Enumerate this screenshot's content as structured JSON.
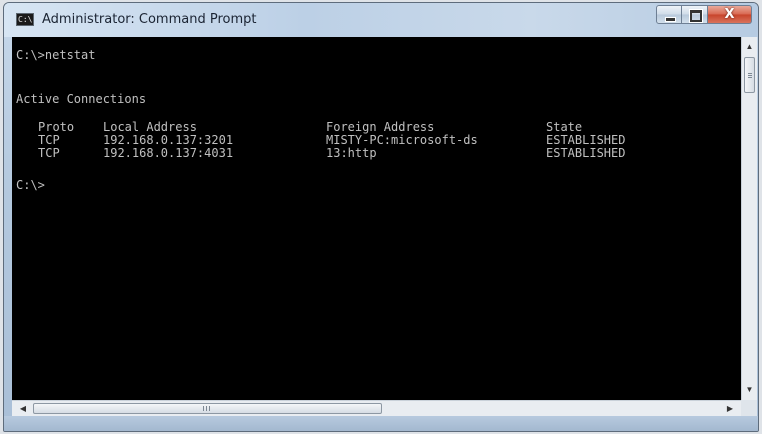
{
  "window": {
    "title": "Administrator: Command Prompt",
    "icon": "cmd-icon",
    "icon_glyph": "C:\\",
    "controls": {
      "minimize": "minimize-icon",
      "maximize": "maximize-icon",
      "close": "close-icon",
      "close_glyph": "X"
    }
  },
  "console": {
    "command_line": "C:\\>netstat",
    "section_title": "Active Connections",
    "headers": [
      "Proto",
      "Local Address",
      "Foreign Address",
      "State"
    ],
    "rows": [
      [
        "TCP",
        "192.168.0.137:3201",
        "MISTY-PC:microsoft-ds",
        "ESTABLISHED"
      ],
      [
        "TCP",
        "192.168.0.137:4031",
        "13:http",
        "ESTABLISHED"
      ]
    ],
    "prompt": "C:\\>"
  },
  "scrollbars": {
    "up_arrow": "▲",
    "down_arrow": "▼",
    "left_arrow": "◀",
    "right_arrow": "▶",
    "grip": "III"
  },
  "colors": {
    "console_bg": "#000000",
    "console_text": "#c0c0c0",
    "close_button": "#c7432a"
  }
}
